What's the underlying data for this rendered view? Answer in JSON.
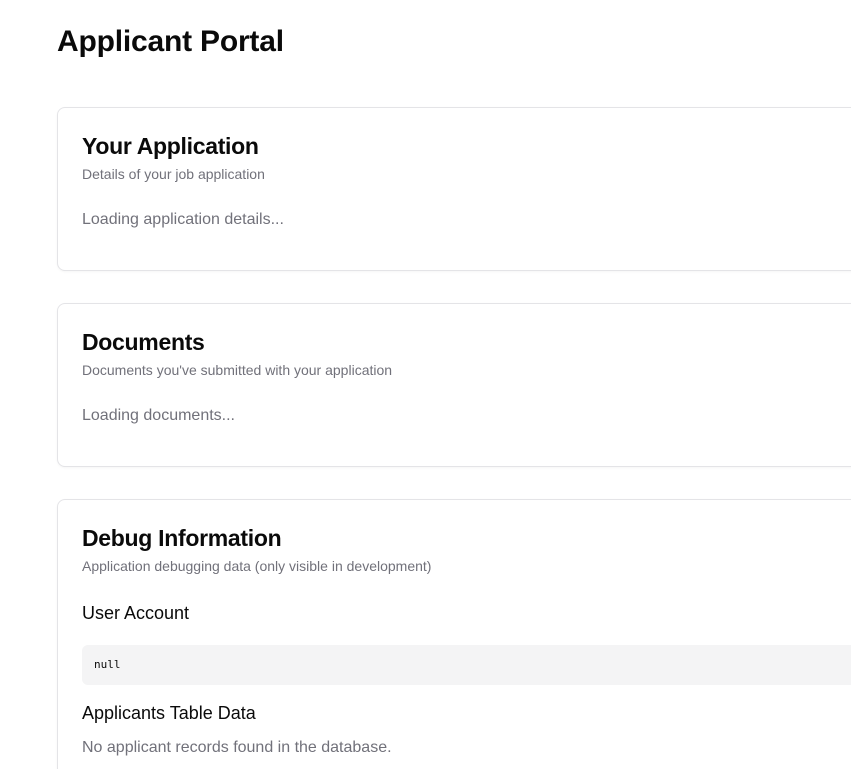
{
  "page": {
    "title": "Applicant Portal"
  },
  "application_card": {
    "title": "Your Application",
    "description": "Details of your job application",
    "status": "Loading application details..."
  },
  "documents_card": {
    "title": "Documents",
    "description": "Documents you've submitted with your application",
    "status": "Loading documents..."
  },
  "debug_card": {
    "title": "Debug Information",
    "description": "Application debugging data (only visible in development)",
    "user_account": {
      "heading": "User Account",
      "value": "null"
    },
    "applicants_table": {
      "heading": "Applicants Table Data",
      "empty_message": "No applicant records found in the database."
    }
  }
}
